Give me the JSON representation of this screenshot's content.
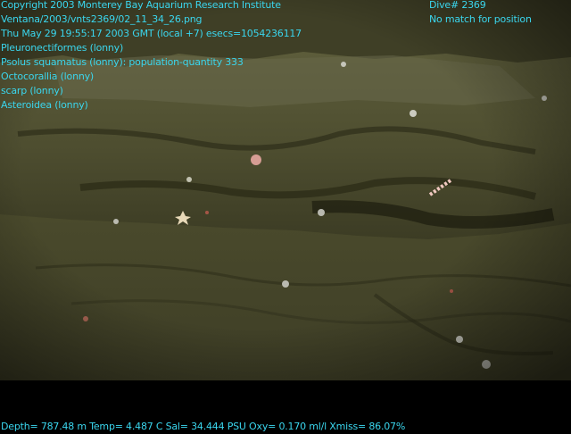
{
  "overlay": {
    "left_lines": [
      "Copyright 2003 Monterey Bay Aquarium Research Institute",
      "Ventana/2003/vnts2369/02_11_34_26.png",
      "Thu May 29 19:55:17 2003 GMT (local +7)  esecs=1054236117",
      "Pleuronectiformes (lonny)",
      "Psolus squamatus (lonny): population-quantity 333",
      "Octocorallia (lonny)",
      "scarp (lonny)",
      "Asteroidea (lonny)"
    ],
    "dive": "Dive# 2369",
    "position": "No match for position",
    "telemetry": "Depth= 787.48 m  Temp= 4.487 C  Sal= 34.444 PSU  Oxy= 0.170 ml/l  Xmiss= 86.07%"
  },
  "colors": {
    "overlay_text": "#3ad6ee",
    "background": "#000000",
    "seafloor": "#4a4a2c"
  }
}
